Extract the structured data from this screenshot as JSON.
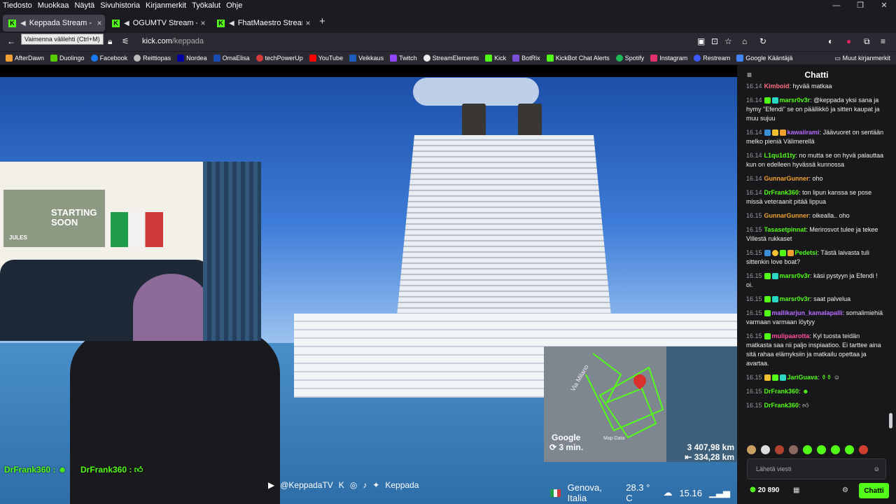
{
  "menubar": {
    "items": [
      "Tiedosto",
      "Muokkaa",
      "Näytä",
      "Sivuhistoria",
      "Kirjanmerkit",
      "Työkalut",
      "Ohje"
    ]
  },
  "window_controls": {
    "minimize": "—",
    "restore": "❐",
    "close": "✕"
  },
  "tabs": [
    {
      "title": "Keppada Stream - Watch L",
      "active": true
    },
    {
      "title": "OGUMTV Stream - Watch L",
      "active": false
    },
    {
      "title": "FhatMaestro Stream - Watc",
      "active": false
    }
  ],
  "tooltip": "Vaimenna välilehti (Ctrl+M)",
  "address": {
    "host": "kick.com",
    "path": "/keppada"
  },
  "bookmarks": [
    {
      "label": "AfterDawn",
      "color": "#f0a030"
    },
    {
      "label": "Duolingo",
      "color": "#58cc02"
    },
    {
      "label": "Facebook",
      "color": "#1877f2"
    },
    {
      "label": "Reittiopas",
      "color": "#bbbbbb"
    },
    {
      "label": "Nordea",
      "color": "#0000a0"
    },
    {
      "label": "OmaElisa",
      "color": "#1a4db3"
    },
    {
      "label": "techPowerUp",
      "color": "#d63a3a"
    },
    {
      "label": "YouTube",
      "color": "#ff0000"
    },
    {
      "label": "Veikkaus",
      "color": "#1f5cc0"
    },
    {
      "label": "Twitch",
      "color": "#9146ff"
    },
    {
      "label": "StreamElements",
      "color": "#eeeeee"
    },
    {
      "label": "Kick",
      "color": "#53fc18"
    },
    {
      "label": "BotRix",
      "color": "#7a4fd8"
    },
    {
      "label": "KickBot Chat Alerts",
      "color": "#53fc18"
    },
    {
      "label": "Spotify",
      "color": "#1db954"
    },
    {
      "label": "Instagram",
      "color": "#e1306c"
    },
    {
      "label": "Restream",
      "color": "#3d5afe"
    },
    {
      "label": "Google Kääntäjä",
      "color": "#4285f4"
    }
  ],
  "bookmarks_other": "Muut kirjanmerkit",
  "stream": {
    "webcam_poster_text": "STARTING SOON",
    "webcam_poster_name": "JULES",
    "map": {
      "street": "Via Milano",
      "brand": "Google",
      "map_data": "Map Data",
      "time": "3 min.",
      "distance_1": "3 407,98 km",
      "distance_2": "334,28 km"
    },
    "chat_overlay": [
      {
        "name": "DrFrank360 :"
      },
      {
        "name": "DrFrank360 :"
      }
    ],
    "socials": {
      "handle": "@KeppadaTV",
      "name": "Keppada"
    },
    "location": "Genova, Italia",
    "temperature": "28.3 ° C",
    "clock": "15.16"
  },
  "chat": {
    "title": "Chatti",
    "messages": [
      {
        "time": "16.14",
        "name": "Kimboid",
        "color": "#ff6b81",
        "text": ": hyvää matkaa"
      },
      {
        "time": "16.14",
        "name": "marsr0v3r",
        "color": "#53fc18",
        "text": ": @keppada yksi sana ja hymy \"Efendi\" se on päällikkö ja sitten kaupat ja muu sujuu"
      },
      {
        "time": "16.14",
        "name": "kawaiirami",
        "color": "#b66bff",
        "text": ": Jäävuoret on sentään melko pieniä Välimerellä"
      },
      {
        "time": "16.14",
        "name": "L1qu1d1ty",
        "color": "#53fc18",
        "text": ": no mutta se on hyvä palauttaa kun on edelleen hyvässä kunnossa"
      },
      {
        "time": "16.14",
        "name": "GunnarGunner",
        "color": "#f0a030",
        "text": ": oho"
      },
      {
        "time": "16.14",
        "name": "DrFrank360",
        "color": "#53fc18",
        "text": ": ton lipun kanssa se pose missä veteraanit pitää lippua"
      },
      {
        "time": "16.15",
        "name": "GunnarGunner",
        "color": "#f0a030",
        "text": ": oikealla.. oho"
      },
      {
        "time": "16.15",
        "name": "Tasasetpinnat",
        "color": "#53fc18",
        "text": ": Merirosvot tulee ja tekee Villestä rukkaset"
      },
      {
        "time": "16.15",
        "name": "Pedetsi",
        "color": "#53fc18",
        "text": ": Tästä laivasta tuli sittenkin love boat?"
      },
      {
        "time": "16.15",
        "name": "marsr0v3r",
        "color": "#53fc18",
        "text": ": käsi pystyyn ja Efendi ! oi."
      },
      {
        "time": "16.15",
        "name": "marsr0v3r",
        "color": "#53fc18",
        "text": ": saat palvelua"
      },
      {
        "time": "16.15",
        "name": "mallikarjun_kamalapalli",
        "color": "#b66bff",
        "text": ": somalimiehiä varmaan varmaan löytyy"
      },
      {
        "time": "16.15",
        "name": "mulipaarotta",
        "color": "#ff4f9a",
        "text": ": Kyl tuosta teidän matkasta saa nii paljo inspiaatioo. Ei tarttee aina sitä rahaa elämyksiin ja matkailu opettaa ja avartaa."
      },
      {
        "time": "16.15",
        "name": "JariGuava",
        "color": "#53fc18",
        "text": ":"
      },
      {
        "time": "16.15",
        "name": "DrFrank360",
        "color": "#53fc18",
        "text": ":"
      },
      {
        "time": "16.15",
        "name": "DrFrank360",
        "color": "#53fc18",
        "text": ":"
      }
    ],
    "input_placeholder": "Lähetä viesti",
    "viewers": "20 890",
    "send_label": "Chatti"
  }
}
